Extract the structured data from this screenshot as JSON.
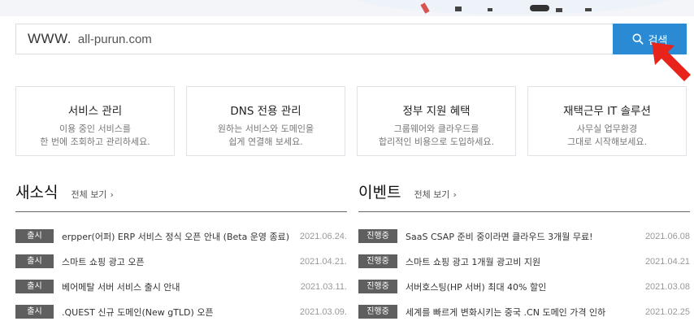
{
  "search": {
    "prefix": "WWW.",
    "value": "all-purun.com",
    "button_label": "검색"
  },
  "cards": [
    {
      "title": "서비스 관리",
      "desc": [
        "이용 중인 서비스를",
        "한 번에 조회하고 관리하세요."
      ]
    },
    {
      "title": "DNS 전용 관리",
      "desc": [
        "원하는 서비스와 도메인을",
        "쉽게 연결해 보세요."
      ]
    },
    {
      "title": "정부 지원 혜택",
      "desc": [
        "그룹웨어와 클라우드를",
        "합리적인 비용으로 도입하세요."
      ]
    },
    {
      "title": "재택근무 IT 솔루션",
      "desc": [
        "사무실 업무환경",
        "그대로 시작해보세요."
      ]
    }
  ],
  "news": {
    "title": "새소식",
    "more": "전체 보기",
    "items": [
      {
        "badge": "출시",
        "title": "erpper(어퍼) ERP 서비스 정식 오픈 안내 (Beta 운영 종료)",
        "date": "2021.06.24."
      },
      {
        "badge": "출시",
        "title": "스마트 쇼핑 광고 오픈",
        "date": "2021.04.21."
      },
      {
        "badge": "출시",
        "title": "베어메탈 서버 서비스 출시 안내",
        "date": "2021.03.11."
      },
      {
        "badge": "출시",
        "title": ".QUEST 신규 도메인(New gTLD) 오픈",
        "date": "2021.03.09."
      }
    ]
  },
  "events": {
    "title": "이벤트",
    "more": "전체 보기",
    "items": [
      {
        "badge": "진행중",
        "title": "SaaS CSAP 준비 중이라면 클라우드 3개월 무료!",
        "date": "2021.06.08"
      },
      {
        "badge": "진행중",
        "title": "스마트 쇼핑 광고 1개월 광고비 지원",
        "date": "2021.04.21"
      },
      {
        "badge": "진행중",
        "title": "서버호스팅(HP 서버) 최대 40% 할인",
        "date": "2021.03.08"
      },
      {
        "badge": "진행중",
        "title": "세계를 빠르게 변화시키는 중국 .CN 도메인 가격 인하",
        "date": "2021.02.25"
      }
    ]
  },
  "colors": {
    "accent": "#2a8bd4",
    "badge": "#5f5f5f",
    "arrow": "#e8231b"
  }
}
